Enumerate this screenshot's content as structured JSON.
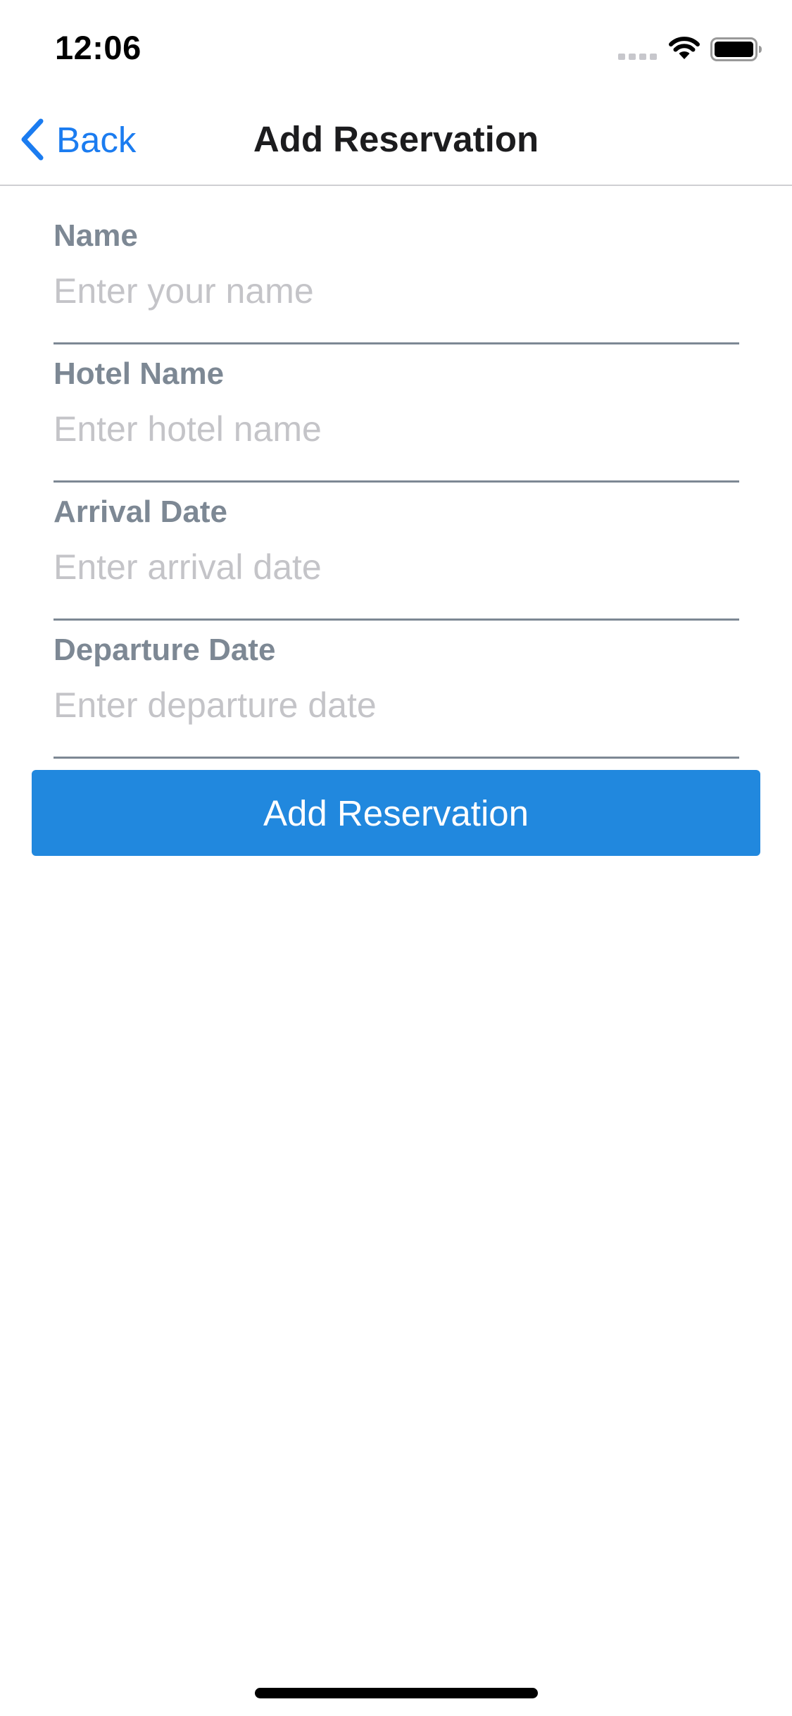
{
  "status_bar": {
    "time": "12:06",
    "icons": [
      "signal-icon",
      "wifi-icon",
      "battery-icon"
    ]
  },
  "nav": {
    "back_label": "Back",
    "title": "Add Reservation",
    "back_icon": "chevron-left-icon"
  },
  "form": {
    "fields": [
      {
        "label": "Name",
        "placeholder": "Enter your name",
        "value": ""
      },
      {
        "label": "Hotel Name",
        "placeholder": "Enter hotel name",
        "value": ""
      },
      {
        "label": "Arrival Date",
        "placeholder": "Enter arrival date",
        "value": ""
      },
      {
        "label": "Departure Date",
        "placeholder": "Enter departure date",
        "value": ""
      }
    ],
    "submit_label": "Add Reservation"
  },
  "colors": {
    "accent": "#1b7cf0",
    "button_background": "#2188de",
    "label": "#7d8894",
    "placeholder": "#c4c4c8",
    "underline": "#7d8894"
  }
}
